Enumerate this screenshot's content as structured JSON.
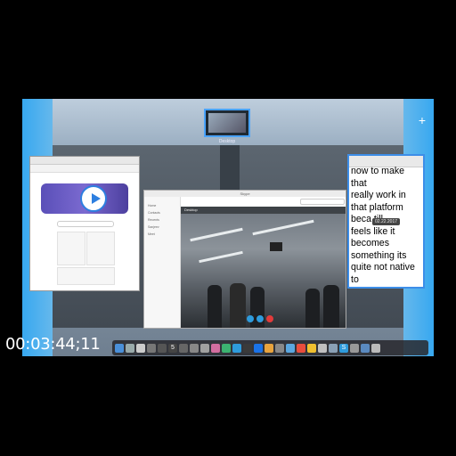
{
  "desktop": {
    "space_label": "Desktop",
    "add_space_symbol": "+"
  },
  "editor": {
    "lines": [
      "now to make",
      "that",
      "really work in",
      "that platform",
      "beca     till",
      "feels like it",
      "becomes",
      "something its",
      "quite not native",
      "to"
    ],
    "date_tooltip": "02.22.2017"
  },
  "skype": {
    "title": "Skype",
    "side_items": [
      "Home",
      "Contacts",
      "Recents",
      "Sanjeev",
      "Meet"
    ],
    "call_header": "Desktop"
  },
  "dock": {
    "icons": [
      "finder-icon",
      "launchpad-icon",
      "safari-icon",
      "mail-icon",
      "contacts-icon",
      "calendar-icon",
      "notes-icon",
      "reminders-icon",
      "maps-icon",
      "photos-icon",
      "messages-icon",
      "facetime-icon",
      "itunes-icon",
      "ibooks-icon",
      "appstore-icon",
      "preferences-icon",
      "skype-icon",
      "chrome-icon",
      "terminal-icon",
      "folder-icon",
      "trash-icon"
    ],
    "labels": [
      "5",
      "S"
    ]
  },
  "timecode": "00:03:44;11"
}
